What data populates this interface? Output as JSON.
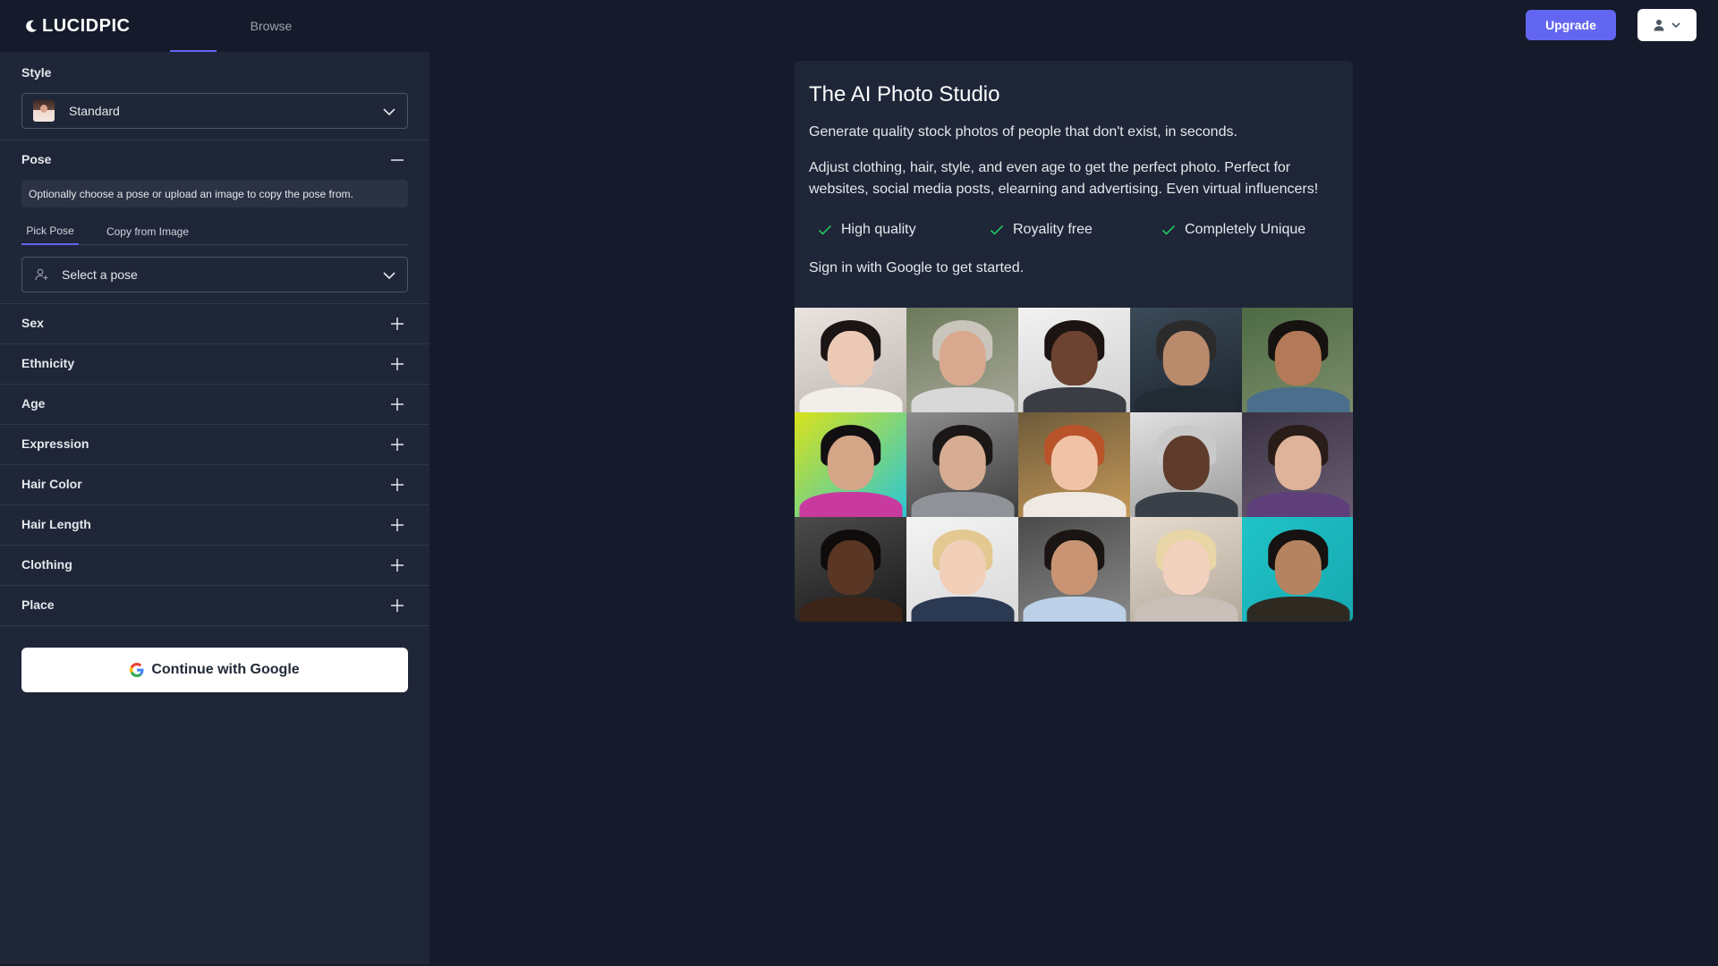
{
  "header": {
    "brand": "LUCIDPIC",
    "nav": [
      "",
      "Browse"
    ],
    "upgrade_label": "Upgrade"
  },
  "sidebar": {
    "style_label": "Style",
    "style_value": "Standard",
    "pose_label": "Pose",
    "pose_hint": "Optionally choose a pose or upload an image to copy the pose from.",
    "pose_tabs": [
      "Pick Pose",
      "Copy from Image"
    ],
    "pose_select_placeholder": "Select a pose",
    "sections": [
      "Sex",
      "Ethnicity",
      "Age",
      "Expression",
      "Hair Color",
      "Hair Length",
      "Clothing",
      "Place"
    ],
    "google_button": "Continue with Google"
  },
  "card": {
    "title": "The AI Photo Studio",
    "intro": "Generate quality stock photos of people that don't exist, in seconds.",
    "details": "Adjust clothing, hair, style, and even age to get the perfect photo. Perfect for websites, social media posts, elearning and advertising. Even virtual influencers!",
    "features": [
      "High quality",
      "Royality free",
      "Completely Unique"
    ],
    "signin": "Sign in with Google to get started."
  },
  "colors": {
    "accent": "#6366f1",
    "page_bg": "#151b2b",
    "panel_bg": "#1f2638",
    "check": "#22c55e"
  },
  "icons": [
    "moon-logo-icon",
    "user-icon",
    "chevron-down-icon",
    "minus-icon",
    "plus-icon",
    "add-person-icon",
    "check-icon",
    "google-icon"
  ]
}
